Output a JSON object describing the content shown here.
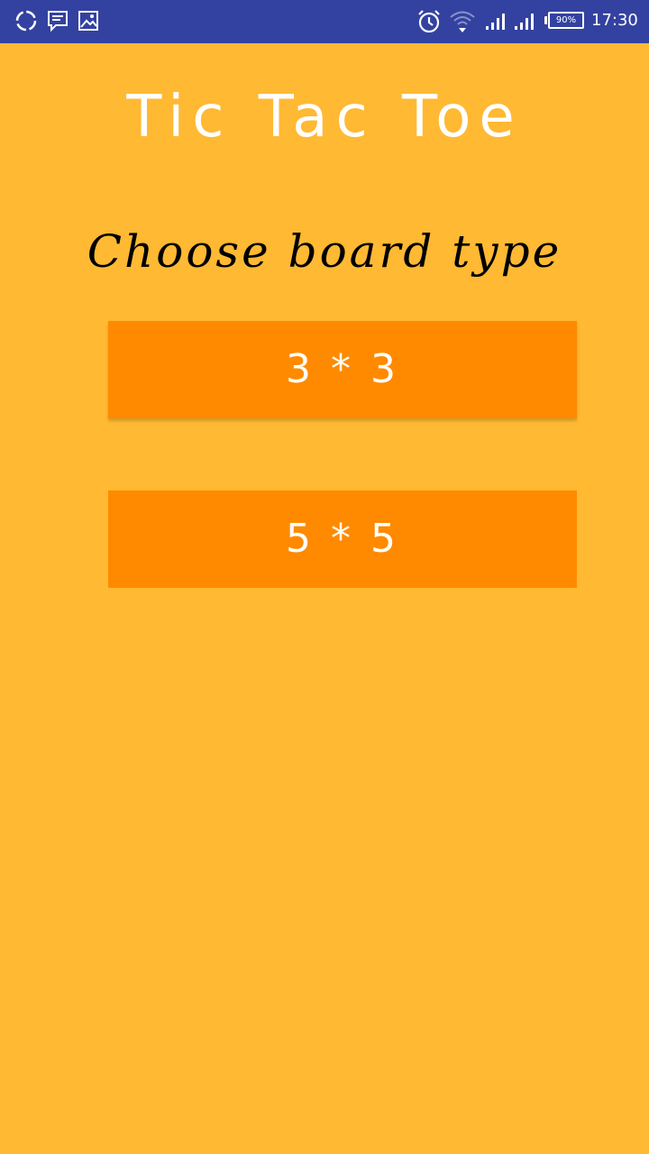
{
  "status_bar": {
    "time": "17:30",
    "battery": "90%",
    "left_icons": [
      "sync-icon",
      "message-icon",
      "image-icon"
    ],
    "right_icons": [
      "alarm-icon",
      "wifi-icon",
      "signal-icon",
      "signal-icon"
    ],
    "background": "#3342A0"
  },
  "app": {
    "title": "Tic Tac Toe",
    "subtitle": "Choose board type",
    "background": "#FFB933"
  },
  "buttons": [
    {
      "label": "3 * 3",
      "color": "#FF8A00"
    },
    {
      "label": "5 * 5",
      "color": "#FF8A00"
    }
  ]
}
